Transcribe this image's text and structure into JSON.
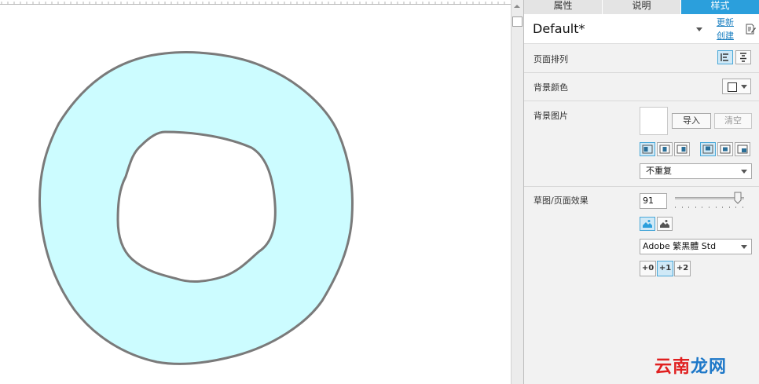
{
  "tabs": [
    {
      "label": "属性",
      "active": false
    },
    {
      "label": "说明",
      "active": false
    },
    {
      "label": "样式",
      "active": true
    }
  ],
  "style_selector": {
    "value": "Default*",
    "update_link": "更新",
    "create_link": "创建"
  },
  "page_arrangement": {
    "label": "页面排列",
    "options": [
      "align-left-icon",
      "align-center-icon"
    ],
    "selected": "align-left-icon"
  },
  "background_color": {
    "label": "背景颜色",
    "value": "#ffffff"
  },
  "background_image": {
    "label": "背景图片",
    "import_button": "导入",
    "clear_button": "清空",
    "repeat_select": "不重复"
  },
  "sketch_effect": {
    "label": "草图/页面效果",
    "sketchiness": 91,
    "slider_max": 100,
    "font_select": "Adobe 繁黑體 Std",
    "line_width_buttons": [
      "+0",
      "+1",
      "+2"
    ],
    "selected_line_width": "+1"
  },
  "colors": {
    "accent": "#2b9fdc",
    "shape_fill": "#ccfcff",
    "shape_stroke": "#7a7a7a",
    "watermark_red": "#e02020",
    "watermark_blue": "#1e78c8"
  },
  "watermark": {
    "part1": "云南",
    "part2": "龙网"
  }
}
